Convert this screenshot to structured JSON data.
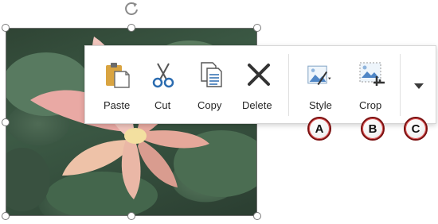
{
  "toolbar": {
    "buttons": [
      {
        "label": "Paste",
        "icon": "paste-icon"
      },
      {
        "label": "Cut",
        "icon": "scissors-icon"
      },
      {
        "label": "Copy",
        "icon": "copy-icon"
      },
      {
        "label": "Delete",
        "icon": "delete-x-icon"
      },
      {
        "label": "Style",
        "icon": "picture-style-icon"
      },
      {
        "label": "Crop",
        "icon": "crop-icon"
      }
    ],
    "more_icon": "chevron-down-icon"
  },
  "callouts": [
    "A",
    "B",
    "C"
  ],
  "colors": {
    "callout_border": "#7a0f0f",
    "icon_blue": "#2b6cb0",
    "icon_dark": "#333333"
  }
}
